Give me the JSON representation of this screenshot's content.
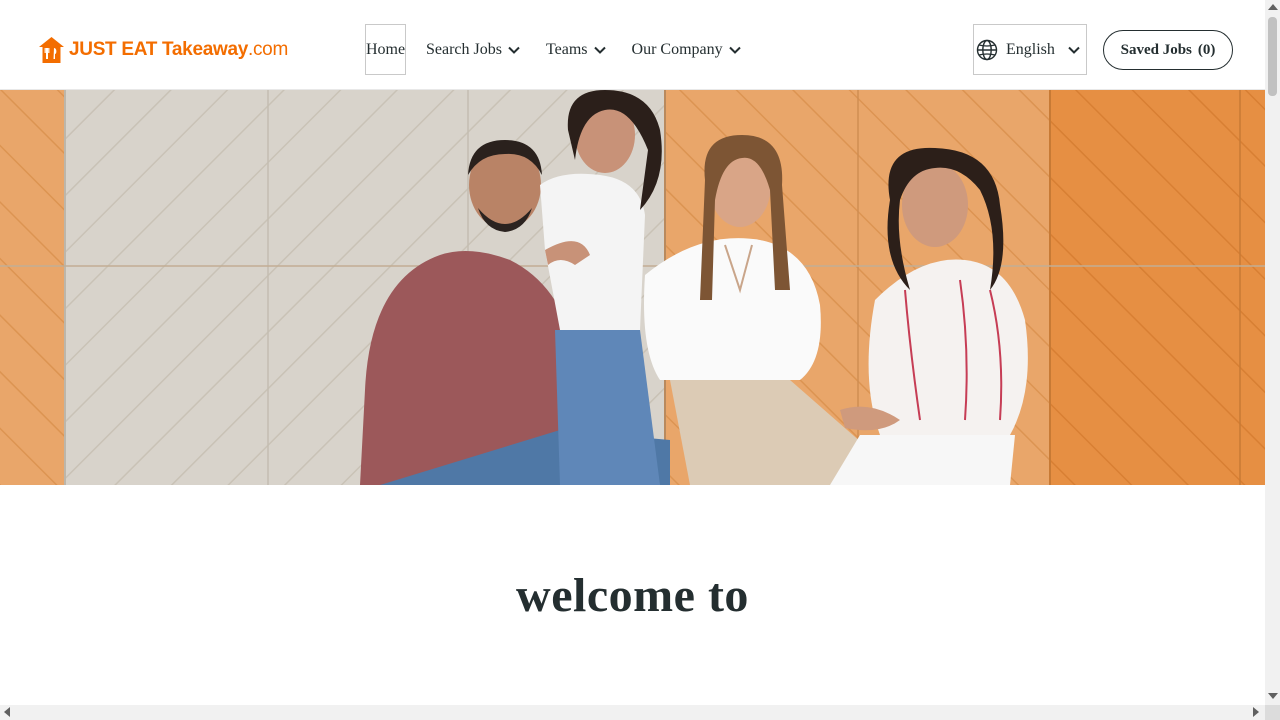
{
  "header": {
    "logo": {
      "text_bold": "JUST EAT Takeaway",
      "text_thin": ".com",
      "icon": "house-fork-knife-icon",
      "color": "#f36d00"
    },
    "nav": {
      "home_label": "Home",
      "search_jobs_label": "Search Jobs",
      "teams_label": "Teams",
      "our_company_label": "Our Company"
    },
    "language": {
      "icon": "globe-icon",
      "label": "English"
    },
    "saved_jobs": {
      "label": "Saved Jobs",
      "count": "(0)"
    }
  },
  "hero": {
    "image": "team-photo-four-people-against-textured-wall"
  },
  "main": {
    "welcome_heading": "welcome to"
  },
  "colors": {
    "brand_orange": "#f36d00",
    "text": "#242e30"
  }
}
